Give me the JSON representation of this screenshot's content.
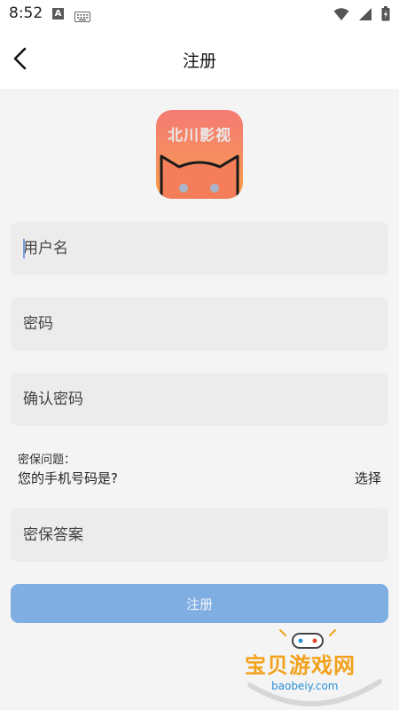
{
  "status_bar": {
    "time": "8:52",
    "notification_glyph": "A",
    "icons": [
      "keyboard-icon",
      "wifi-icon",
      "signal-icon",
      "battery-icon"
    ]
  },
  "header": {
    "title": "注册",
    "back_icon": "back-arrow-icon"
  },
  "logo": {
    "text": "北川影视"
  },
  "form": {
    "username_placeholder": "用户名",
    "password_placeholder": "密码",
    "confirm_password_placeholder": "确认密码",
    "security_label": "密保问题：",
    "security_question": "您的手机号码是?",
    "select_label": "选择",
    "answer_placeholder": "密保答案",
    "submit_label": "注册"
  },
  "watermark": {
    "text": "宝贝游戏网",
    "url": "baobeiy.com"
  },
  "colors": {
    "submit_button": "#7eaee2",
    "field_background": "#ececec",
    "page_background": "#f4f4f4",
    "logo_gradient_top": "#f47a74",
    "logo_gradient_bottom": "#f9a046"
  }
}
